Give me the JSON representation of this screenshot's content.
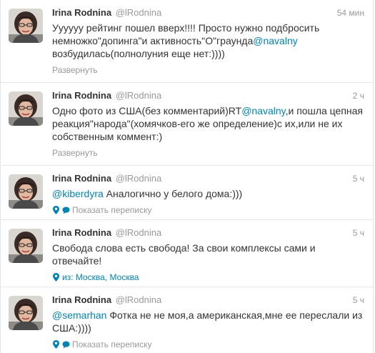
{
  "user": {
    "fullname": "Irina Rodnina",
    "handle": "@lRodnina"
  },
  "colors": {
    "link": "#0084b4",
    "muted": "#999999",
    "text": "#333333"
  },
  "tweets": [
    {
      "time": "54 мин",
      "text_parts": [
        {
          "t": "Уууууу рейтинг пошел вверх!!!! Просто нужно подбросить немножко\"допинга\"и активность\"О\"граунда"
        },
        {
          "m": "@navalny"
        },
        {
          "t": " возбудилась(полнолуния еще нет:))))"
        }
      ],
      "action": {
        "label": "Развернуть",
        "icon": "none"
      }
    },
    {
      "time": "2 ч",
      "text_parts": [
        {
          "t": "Одно фото из США(без комментарий)RT"
        },
        {
          "m": "@navalny"
        },
        {
          "t": ",и пошла цепная реакция\"народа\"(хомячков-его же определение)с их,или не их собственным коммент:)"
        }
      ],
      "action": {
        "label": "Развернуть",
        "icon": "none"
      }
    },
    {
      "time": "5 ч",
      "text_parts": [
        {
          "m": "@kiberdyra"
        },
        {
          "t": " Аналогично у белого дома:)))"
        }
      ],
      "action": {
        "label": "Показать переписку",
        "icon": "location-and-conversation"
      }
    },
    {
      "time": "5 ч",
      "text_parts": [
        {
          "t": "Свобода слова есть свобода! За свои комплексы сами и отвечайте!"
        }
      ],
      "action": {
        "label": "из: Москва, Москва",
        "icon": "location"
      }
    },
    {
      "time": "5 ч",
      "text_parts": [
        {
          "m": "@semarhan"
        },
        {
          "t": " Фотка не не моя,а американская,мне ее переслали из США:))))"
        }
      ],
      "action": {
        "label": "Показать переписку",
        "icon": "location-and-conversation"
      }
    }
  ]
}
